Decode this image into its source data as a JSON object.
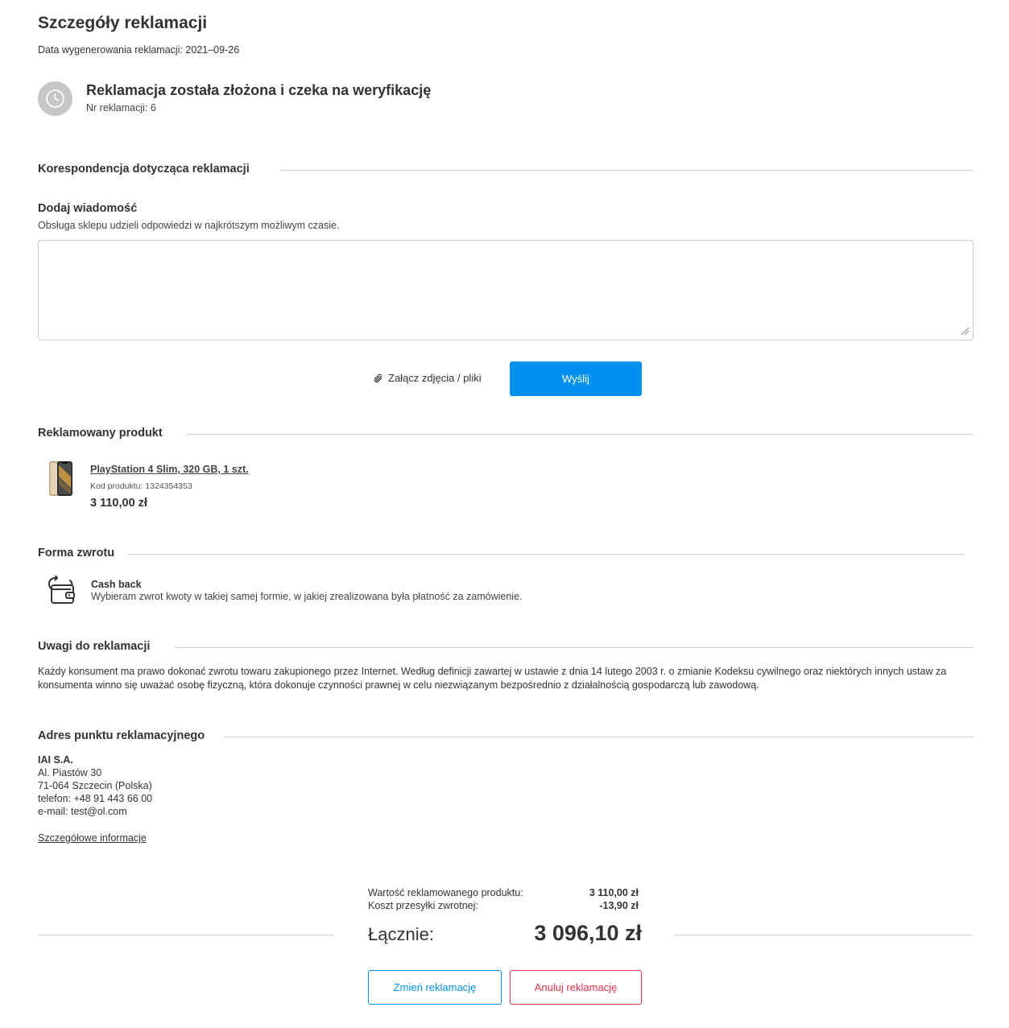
{
  "page": {
    "title": "Szczegóły reklamacji",
    "generation_date": "Data wygenerowania reklamacji: 2021–09-26"
  },
  "status": {
    "icon": "clock-icon",
    "title": "Reklamacja została złożona i czeka na weryfikację",
    "number": "Nr reklamacji: 6"
  },
  "correspondence": {
    "section_title": "Korespondencja dotycząca reklamacji",
    "add_title": "Dodaj wiadomość",
    "add_desc": "Obsługa sklepu udzieli odpowiedzi w najkrótszym możliwym czasie.",
    "textarea_value": "",
    "attach_label": "Załącz zdjęcia / pliki",
    "send_label": "Wyślij"
  },
  "product": {
    "section_title": "Reklamowany produkt",
    "name": "PlayStation 4 Slim, 320 GB, 1 szt.",
    "code": "Kod produktu: 1324354353",
    "price": "3 110,00 zł"
  },
  "refund": {
    "section_title": "Forma zwrotu",
    "icon": "wallet-return-icon",
    "name": "Cash back",
    "desc": "Wybieram zwrot kwoty w takiej samej formie, w jakiej zrealizowana była płatność za zamówienie."
  },
  "notes": {
    "section_title": "Uwagi do reklamacji",
    "text": "Każdy konsument ma prawo dokonać zwrotu towaru zakupionego przez Internet. Według definicji zawartej w ustawie z dnia 14 lutego 2003 r. o zmianie Kodeksu cywilnego oraz niektórych innych ustaw za konsumenta winno się uważać osobę fizyczną, która dokonuje czynności prawnej w celu niezwiązanym bezpośrednio z działalnością gospodarczą lub zawodową."
  },
  "address": {
    "section_title": "Adres punktu reklamacyjnego",
    "company": "IAI S.A.",
    "street": "Al. Piastów 30",
    "city": "71-064 Szczecin (Polska)",
    "phone": "telefon: +48 91 443 66 00",
    "email": "e-mail: test@ol.com",
    "details_link": "Szczegółowe informacje"
  },
  "summary": {
    "product_value_label": "Wartość reklamowanego produktu:",
    "product_value": "3 110,00 zł",
    "shipping_label": "Koszt przesyłki zwrotnej:",
    "shipping_value": "-13,90 zł",
    "total_label": "Łącznie:",
    "total_value": "3 096,10 zł"
  },
  "actions": {
    "change_label": "Zmień reklamację",
    "cancel_label": "Anuluj reklamację"
  },
  "colors": {
    "primary": "#0090f0",
    "danger": "#e0324b",
    "status_circle": "#c6c6c6"
  }
}
